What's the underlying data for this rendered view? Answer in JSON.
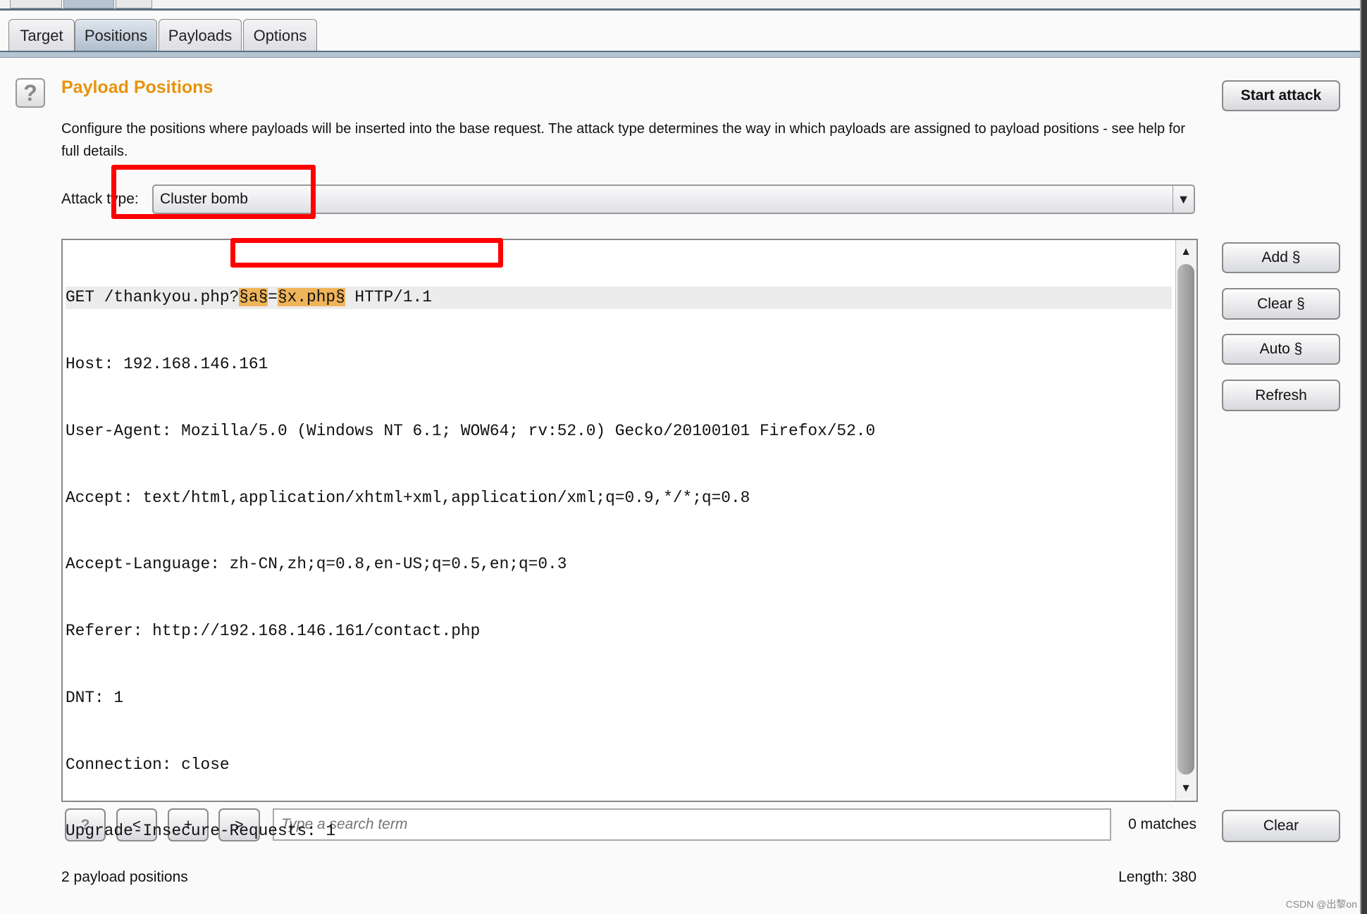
{
  "tabs": [
    {
      "label": "Target"
    },
    {
      "label": "Positions",
      "active": true
    },
    {
      "label": "Payloads"
    },
    {
      "label": "Options"
    }
  ],
  "section": {
    "title": "Payload Positions",
    "description": "Configure the positions where payloads will be inserted into the base request. The attack type determines the way in which payloads are assigned to payload positions - see help for full details.",
    "help_icon": "?"
  },
  "start_attack_label": "Start attack",
  "attack_type": {
    "label": "Attack type:",
    "value": "Cluster bomb"
  },
  "request": {
    "line0": {
      "prefix": "GET /thankyou.php?",
      "p1": "§a§",
      "eq": "=",
      "p2": "§x.php§",
      "suffix": " HTTP/1.1"
    },
    "lines": [
      "Host: 192.168.146.161",
      "User-Agent: Mozilla/5.0 (Windows NT 6.1; WOW64; rv:52.0) Gecko/20100101 Firefox/52.0",
      "Accept: text/html,application/xhtml+xml,application/xml;q=0.9,*/*;q=0.8",
      "Accept-Language: zh-CN,zh;q=0.8,en-US;q=0.5,en;q=0.3",
      "Referer: http://192.168.146.161/contact.php",
      "DNT: 1",
      "Connection: close",
      "Upgrade-Insecure-Requests: 1"
    ]
  },
  "side_buttons": {
    "add": "Add §",
    "clear": "Clear §",
    "auto": "Auto §",
    "refresh": "Refresh"
  },
  "search": {
    "help": "?",
    "prev": "<",
    "plus": "+",
    "next": ">",
    "placeholder": "Type a search term",
    "matches": "0 matches",
    "clear": "Clear"
  },
  "status": {
    "positions": "2 payload positions",
    "length": "Length: 380"
  },
  "colors": {
    "title": "#e8930c",
    "highlight": "#efb45a",
    "annotation": "#ff0000"
  },
  "watermark": "CSDN @出黎on"
}
